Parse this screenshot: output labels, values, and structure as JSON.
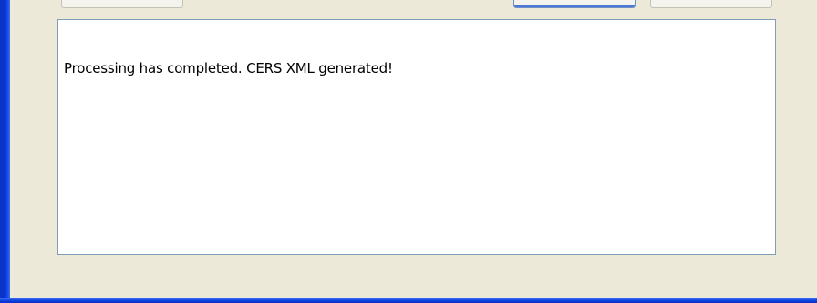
{
  "window": {
    "colors": {
      "background": "#ECE9D8",
      "frame": "#0A32D0",
      "box_background": "#FFFFFF",
      "box_border": "#7F9DB9"
    }
  },
  "top_buttons": {
    "left_label": "",
    "default_label": "",
    "right_label": ""
  },
  "message": {
    "text": "Processing has completed. CERS XML generated!"
  }
}
